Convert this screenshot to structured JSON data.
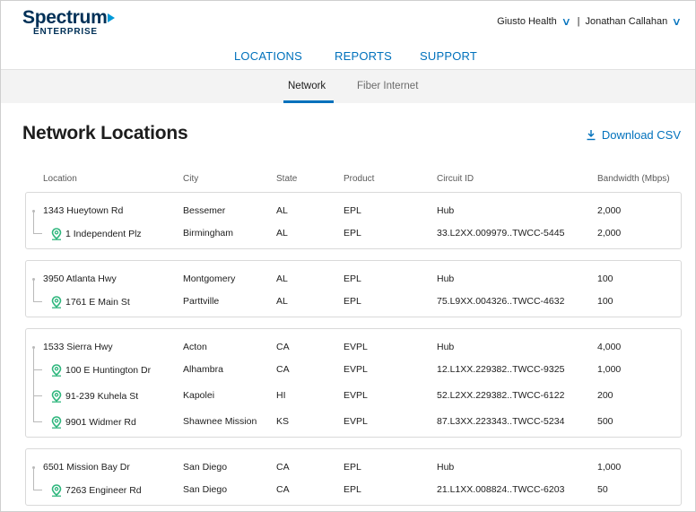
{
  "logo": {
    "brand": "Spectrum",
    "sub": "ENTERPRISE"
  },
  "account": {
    "org": "Giusto Health",
    "separator": "|",
    "user": "Jonathan Callahan"
  },
  "main_nav": [
    "LOCATIONS",
    "REPORTS",
    "SUPPORT"
  ],
  "sub_nav": {
    "active": "Network",
    "inactive": "Fiber Internet"
  },
  "page_title": "Network Locations",
  "download_label": "Download CSV",
  "columns": [
    "Location",
    "City",
    "State",
    "Product",
    "Circuit ID",
    "Bandwidth (Mbps)"
  ],
  "groups": [
    {
      "rows": [
        {
          "location": "1343 Hueytown Rd",
          "city": "Bessemer",
          "state": "AL",
          "product": "EPL",
          "circuit": "Hub",
          "bandwidth": "2,000"
        },
        {
          "location": "1 Independent Plz",
          "city": "Birmingham",
          "state": "AL",
          "product": "EPL",
          "circuit": "33.L2XX.009979..TWCC-5445",
          "bandwidth": "2,000"
        }
      ]
    },
    {
      "rows": [
        {
          "location": "3950 Atlanta Hwy",
          "city": "Montgomery",
          "state": "AL",
          "product": "EPL",
          "circuit": "Hub",
          "bandwidth": "100"
        },
        {
          "location": "1761 E Main St",
          "city": "Parttville",
          "state": "AL",
          "product": "EPL",
          "circuit": "75.L9XX.004326..TWCC-4632",
          "bandwidth": "100"
        }
      ]
    },
    {
      "rows": [
        {
          "location": "1533 Sierra Hwy",
          "city": "Acton",
          "state": "CA",
          "product": "EVPL",
          "circuit": "Hub",
          "bandwidth": "4,000"
        },
        {
          "location": "100 E Huntington Dr",
          "city": "Alhambra",
          "state": "CA",
          "product": "EVPL",
          "circuit": "12.L1XX.229382..TWCC-9325",
          "bandwidth": "1,000"
        },
        {
          "location": "91-239 Kuhela St",
          "city": "Kapolei",
          "state": "HI",
          "product": "EVPL",
          "circuit": "52.L2XX.229382..TWCC-6122",
          "bandwidth": "200"
        },
        {
          "location": "9901 Widmer Rd",
          "city": "Shawnee Mission",
          "state": "KS",
          "product": "EVPL",
          "circuit": "87.L3XX.223343..TWCC-5234",
          "bandwidth": "500"
        }
      ]
    },
    {
      "rows": [
        {
          "location": "6501 Mission Bay Dr",
          "city": "San Diego",
          "state": "CA",
          "product": "EPL",
          "circuit": "Hub",
          "bandwidth": "1,000"
        },
        {
          "location": "7263 Engineer Rd",
          "city": "San Diego",
          "state": "CA",
          "product": "EPL",
          "circuit": "21.L1XX.008824..TWCC-6203",
          "bandwidth": "50"
        }
      ]
    }
  ],
  "icons": {
    "location": "map-pin-icon",
    "download": "download-icon",
    "dropdown": "chevron-down-icon"
  },
  "colors": {
    "accent": "#0071bc",
    "pin": "#2eb67d",
    "brand": "#003057"
  }
}
